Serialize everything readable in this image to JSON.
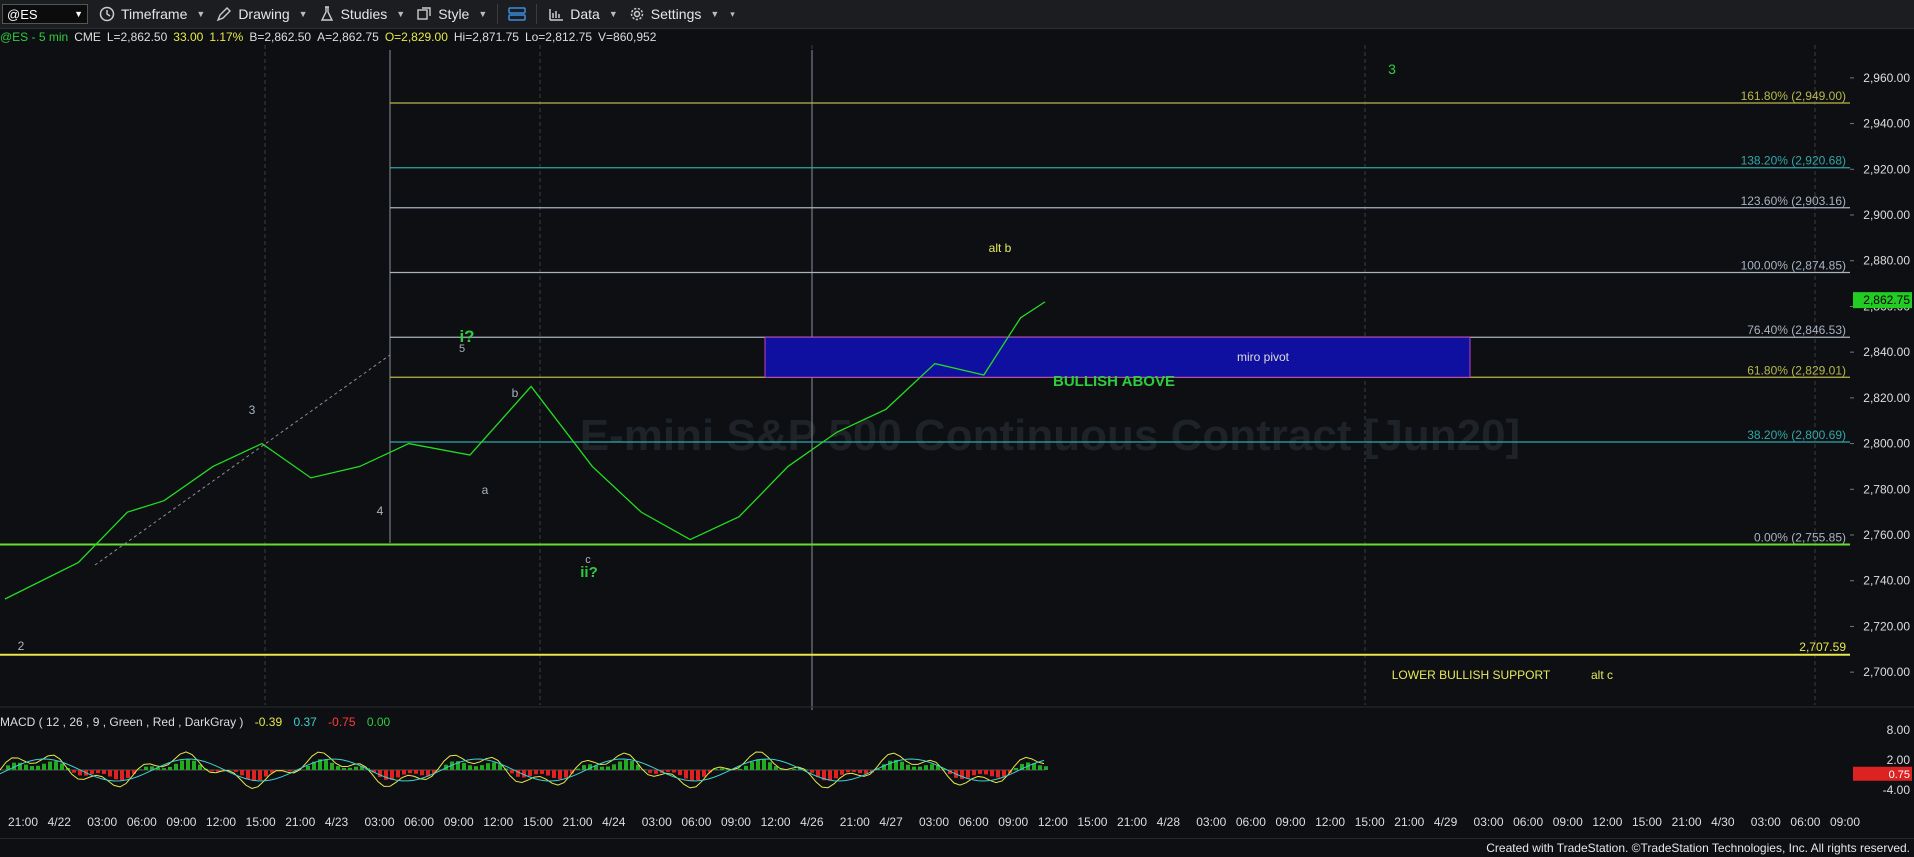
{
  "toolbar": {
    "symbol": "@ES",
    "menus": [
      {
        "label": "Timeframe",
        "icon": "clock-icon"
      },
      {
        "label": "Drawing",
        "icon": "pencil-icon"
      },
      {
        "label": "Studies",
        "icon": "flask-icon"
      },
      {
        "label": "Style",
        "icon": "style-icon"
      },
      {
        "label": "",
        "icon": "layout-icon"
      },
      {
        "label": "Data",
        "icon": "bar-chart-icon"
      },
      {
        "label": "Settings",
        "icon": "gear-icon"
      }
    ]
  },
  "quote": {
    "symbol": "@ES - 5 min",
    "exchange": "CME",
    "last": "L=2,862.50",
    "change": "33.00",
    "pct": "1.17%",
    "bid": "B=2,862.50",
    "ask": "A=2,862.75",
    "open": "O=2,829.00",
    "high": "Hi=2,871.75",
    "low": "Lo=2,812.75",
    "volume": "V=860,952"
  },
  "watermark": "E-mini S&P 500 Continuous Contract [Jun20]",
  "colors": {
    "price": "#22dd22",
    "fib_olive": "#b8b84a",
    "fib_teal": "#2fa8a8",
    "fib_gray": "#a8b4c0",
    "label_green": "#2ecc40",
    "label_yellow": "#e8e85a",
    "pivot": "#1010a0",
    "support": "#e8e84a"
  },
  "chart_data": [
    {
      "type": "line",
      "name": "price",
      "y_axis": {
        "min": 2690,
        "max": 2970,
        "ticks": [
          "2,700.00",
          "2,720.00",
          "2,740.00",
          "2,760.00",
          "2,780.00",
          "2,800.00",
          "2,820.00",
          "2,840.00",
          "2,860.00",
          "2,880.00",
          "2,900.00",
          "2,920.00",
          "2,940.00",
          "2,960.00"
        ]
      },
      "last_price_tag": "2,862.75",
      "x_ticks": [
        "21:00",
        "4/22",
        "03:00",
        "06:00",
        "09:00",
        "12:00",
        "15:00",
        "21:00",
        "4/23",
        "03:00",
        "06:00",
        "09:00",
        "12:00",
        "15:00",
        "21:00",
        "4/24",
        "03:00",
        "06:00",
        "09:00",
        "12:00",
        "4/26",
        "21:00",
        "4/27",
        "03:00",
        "06:00",
        "09:00",
        "12:00",
        "15:00",
        "21:00",
        "4/28",
        "03:00",
        "06:00",
        "09:00",
        "12:00",
        "15:00",
        "21:00",
        "4/29",
        "03:00",
        "06:00",
        "09:00",
        "12:00",
        "15:00",
        "21:00",
        "4/30",
        "03:00",
        "06:00",
        "09:00"
      ],
      "x": [
        0,
        60,
        100,
        130,
        170,
        210,
        250,
        290,
        330,
        380,
        430,
        480,
        520,
        560,
        600,
        640,
        680,
        720,
        760,
        800,
        830,
        850
      ],
      "y": [
        2732,
        2748,
        2770,
        2775,
        2790,
        2800,
        2785,
        2790,
        2800,
        2795,
        2825,
        2790,
        2770,
        2758,
        2768,
        2790,
        2805,
        2815,
        2835,
        2830,
        2855,
        2862
      ],
      "fib_levels": [
        {
          "label": "161.80% (2,949.00)",
          "value": 2949.0,
          "color": "olive"
        },
        {
          "label": "138.20% (2,920.68)",
          "value": 2920.68,
          "color": "teal"
        },
        {
          "label": "123.60% (2,903.16)",
          "value": 2903.16,
          "color": "gray"
        },
        {
          "label": "100.00% (2,874.85)",
          "value": 2874.85,
          "color": "gray"
        },
        {
          "label": "76.40% (2,846.53)",
          "value": 2846.53,
          "color": "gray"
        },
        {
          "label": "61.80% (2,829.01)",
          "value": 2829.01,
          "color": "olive"
        },
        {
          "label": "38.20% (2,800.69)",
          "value": 2800.69,
          "color": "teal"
        },
        {
          "label": "0.00% (2,755.85)",
          "value": 2755.85,
          "color": "gray"
        }
      ],
      "support_line": {
        "label": "2,707.59",
        "value": 2707.59
      },
      "annotations": [
        {
          "text": "3",
          "color": "green"
        },
        {
          "text": "alt b",
          "color": "yellow"
        },
        {
          "text": "i?",
          "color": "green"
        },
        {
          "text": "5",
          "color": "gray"
        },
        {
          "text": "3",
          "color": "gray"
        },
        {
          "text": "b",
          "color": "gray"
        },
        {
          "text": "a",
          "color": "gray"
        },
        {
          "text": "4",
          "color": "gray"
        },
        {
          "text": "c",
          "color": "gray"
        },
        {
          "text": "ii?",
          "color": "green"
        },
        {
          "text": "2",
          "color": "gray"
        },
        {
          "text": "BULLISH ABOVE",
          "color": "green"
        },
        {
          "text": "LOWER BULLISH SUPPORT",
          "color": "yellow"
        },
        {
          "text": "alt c",
          "color": "yellow"
        }
      ],
      "pivot_box": {
        "label": "miro pivot",
        "from": 2829.01,
        "to": 2846.53
      }
    },
    {
      "type": "line",
      "name": "MACD",
      "legend": "MACD ( 12 , 26 , 9 , Green , Red , DarkGray )",
      "values": [
        "-0.39",
        "0.37",
        "-0.75",
        "0.00"
      ],
      "y_ticks": [
        "8.00",
        "2.00",
        "-4.00"
      ],
      "last_tag": "0.75"
    }
  ],
  "footer": {
    "credit": "Created with TradeStation. ©TradeStation Technologies, Inc. All rights reserved."
  }
}
